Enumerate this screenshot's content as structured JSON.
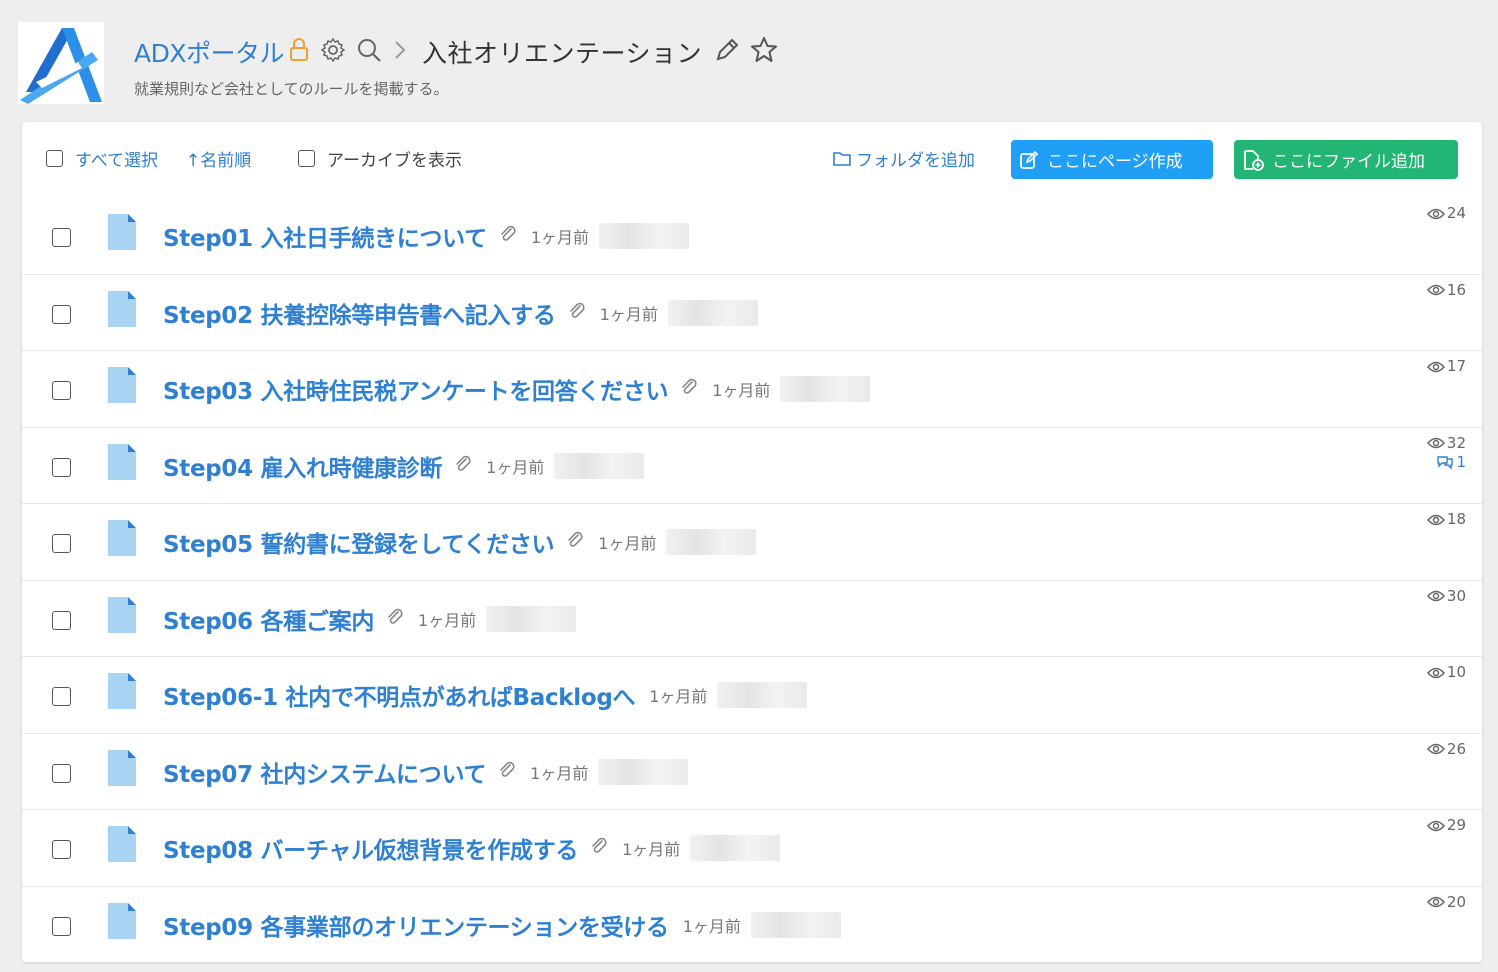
{
  "header": {
    "portal_name": "ADXポータル",
    "page_title": "入社オリエンテーション",
    "description": "就業規則など会社としてのルールを掲載する。"
  },
  "toolbar": {
    "select_all": "すべて選択",
    "sort_label": "↑名前順",
    "show_archive": "アーカイブを表示",
    "add_folder": "フォルダを追加",
    "create_page": "ここにページ作成",
    "add_file": "ここにファイル追加"
  },
  "colors": {
    "link": "#2f80d1",
    "create_page_button": "#1f9ff5",
    "add_file_button": "#22b573",
    "lock_icon": "#f0a030"
  },
  "pages": [
    {
      "title": "Step01 入社日手続きについて",
      "attachment": true,
      "time": "1ヶ月前",
      "views": "24",
      "comments": ""
    },
    {
      "title": "Step02 扶養控除等申告書へ記入する",
      "attachment": true,
      "time": "1ヶ月前",
      "views": "16",
      "comments": ""
    },
    {
      "title": "Step03 入社時住民税アンケートを回答ください",
      "attachment": true,
      "time": "1ヶ月前",
      "views": "17",
      "comments": ""
    },
    {
      "title": "Step04 雇入れ時健康診断",
      "attachment": true,
      "time": "1ヶ月前",
      "views": "32",
      "comments": "1"
    },
    {
      "title": "Step05 誓約書に登録をしてください",
      "attachment": true,
      "time": "1ヶ月前",
      "views": "18",
      "comments": ""
    },
    {
      "title": "Step06 各種ご案内",
      "attachment": true,
      "time": "1ヶ月前",
      "views": "30",
      "comments": ""
    },
    {
      "title": "Step06-1 社内で不明点があればBacklogへ",
      "attachment": false,
      "time": "1ヶ月前",
      "views": "10",
      "comments": ""
    },
    {
      "title": "Step07 社内システムについて",
      "attachment": true,
      "time": "1ヶ月前",
      "views": "26",
      "comments": ""
    },
    {
      "title": "Step08 バーチャル仮想背景を作成する",
      "attachment": true,
      "time": "1ヶ月前",
      "views": "29",
      "comments": ""
    },
    {
      "title": "Step09 各事業部のオリエンテーションを受ける",
      "attachment": false,
      "time": "1ヶ月前",
      "views": "20",
      "comments": ""
    }
  ]
}
